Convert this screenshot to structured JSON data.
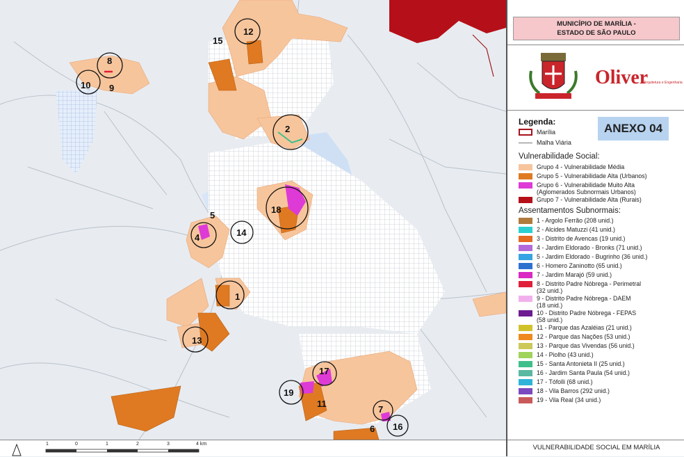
{
  "title": {
    "line1": "MUNICÍPIO DE MARÍLIA -",
    "line2": "ESTADO DE SÃO PAULO"
  },
  "logo_text": "Oliver",
  "logo_sub": "Arquitetura e Engenharia",
  "legend": {
    "title": "Legenda:",
    "marilia": "Marília",
    "malha": "Malha Viária",
    "vuln_title": "Vulnerabilidade Social:",
    "groups": [
      {
        "label": "Grupo 4 - Vulnerabilidade Média",
        "color": "#f7c59c"
      },
      {
        "label": "Grupo 5 - Vulnerabilidade Alta (Urbanos)",
        "color": "#df7a22"
      },
      {
        "label": "Grupo 6 - Vulnerabilidade Muito Alta",
        "label2": "(Aglomerados Subnormais Urbanos)",
        "color": "#dd3ad6"
      },
      {
        "label": "Grupo 7 - Vulnerabilidade Alta (Rurais)",
        "color": "#b51019"
      }
    ],
    "assent_title": "Assentamentos Subnormais:",
    "settlements": [
      {
        "label": "1 - Argolo Ferrão (208 unid.)",
        "color": "#b07b3b"
      },
      {
        "label": "2 - Alcides Matuzzi (41 unid.)",
        "color": "#2bcfd2"
      },
      {
        "label": "3 - Distrito de Avencas (19 unid.)",
        "color": "#e46a22"
      },
      {
        "label": "4 - Jardim Eldorado - Bronks (71 unid.)",
        "color": "#b36ad8"
      },
      {
        "label": "5 - Jardim Eldorado - Bugrinho (36 unid.)",
        "color": "#36a4e2"
      },
      {
        "label": "6 - Homero Zaninotto (65 unid.)",
        "color": "#2e72cf"
      },
      {
        "label": "7 - Jardim Marajó (59 unid.)",
        "color": "#d928c4"
      },
      {
        "label": "8 - Distrito Padre Nóbrega - Perimetral",
        "label2": "(32 unid.)",
        "color": "#e0203a"
      },
      {
        "label": "9 - Distrito Padre Nóbrega - DAEM",
        "label2": "(18 unid.)",
        "color": "#f1b0ec"
      },
      {
        "label": "10 - Distrito Padre Nóbrega - FEPAS",
        "label2": "(58 unid.)",
        "color": "#6d1b91"
      },
      {
        "label": "11 - Parque das Azaléias (21 unid.)",
        "color": "#d1c22a"
      },
      {
        "label": "12 - Parque das Nações (53 unid.)",
        "color": "#ef8a1e"
      },
      {
        "label": "13 - Parque das Vivendas (56 unid.)",
        "color": "#cdc85a"
      },
      {
        "label": "14 - Piolho (43 unid.)",
        "color": "#9fd35a"
      },
      {
        "label": "15 - Santa Antonieta II (25 unid.)",
        "color": "#3fbf8a"
      },
      {
        "label": "16 - Jardim Santa Paula (54 unid.)",
        "color": "#5ab9a0"
      },
      {
        "label": "17 - Tófolli (68 unid.)",
        "color": "#2fb3d8"
      },
      {
        "label": "18 - Vila Barros (292 unid.)",
        "color": "#7a4ac0"
      },
      {
        "label": "19 - Vila Real (34 unid.)",
        "color": "#c95a5a"
      }
    ]
  },
  "anexo": "ANEXO 04",
  "footer": "VULNERABILIDADE SOCIAL EM MARÍLIA",
  "scale": {
    "ticks": [
      "1",
      "0",
      "1",
      "2",
      "3",
      "4 km"
    ]
  },
  "map_labels": [
    "12",
    "15",
    "8",
    "10",
    "9",
    "2",
    "18",
    "5",
    "4",
    "14",
    "1",
    "13",
    "17",
    "19",
    "11",
    "7",
    "6",
    "16"
  ]
}
